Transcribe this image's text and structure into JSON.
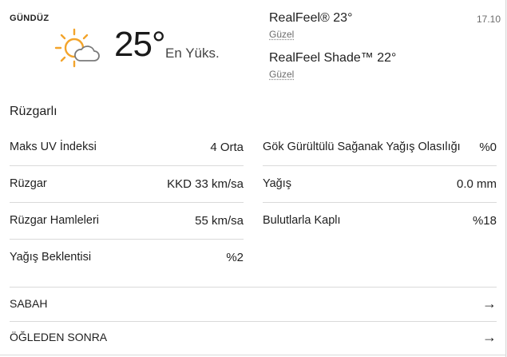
{
  "header": {
    "daypart": "GÜNDÜZ",
    "temperature": "25°",
    "temp_label": "En Yüks.",
    "weather_icon": "partly-sunny-icon",
    "time": "17.10"
  },
  "realfeel": {
    "value": "RealFeel® 23°",
    "desc": "Güzel",
    "shade_value": "RealFeel Shade™ 22°",
    "shade_desc": "Güzel"
  },
  "phrase": "Rüzgarlı",
  "details_left": [
    {
      "label": "Maks UV İndeksi",
      "value": "4 Orta"
    },
    {
      "label": "Rüzgar",
      "value": "KKD 33 km/sa"
    },
    {
      "label": "Rüzgar Hamleleri",
      "value": "55 km/sa"
    },
    {
      "label": "Yağış Beklentisi",
      "value": "%2"
    }
  ],
  "details_right": [
    {
      "label": "Gök Gürültülü Sağanak Yağış Olasılığı",
      "value": "%0"
    },
    {
      "label": "Yağış",
      "value": "0.0 mm"
    },
    {
      "label": "Bulutlarla Kaplı",
      "value": "%18"
    }
  ],
  "nav": [
    {
      "label": "SABAH",
      "icon": "arrow-right-icon"
    },
    {
      "label": "ÖĞLEDEN SONRA",
      "icon": "arrow-right-icon"
    }
  ],
  "colors": {
    "sun": "#f3a42b",
    "cloud_stroke": "#7a7a7a",
    "divider": "#dadada"
  }
}
